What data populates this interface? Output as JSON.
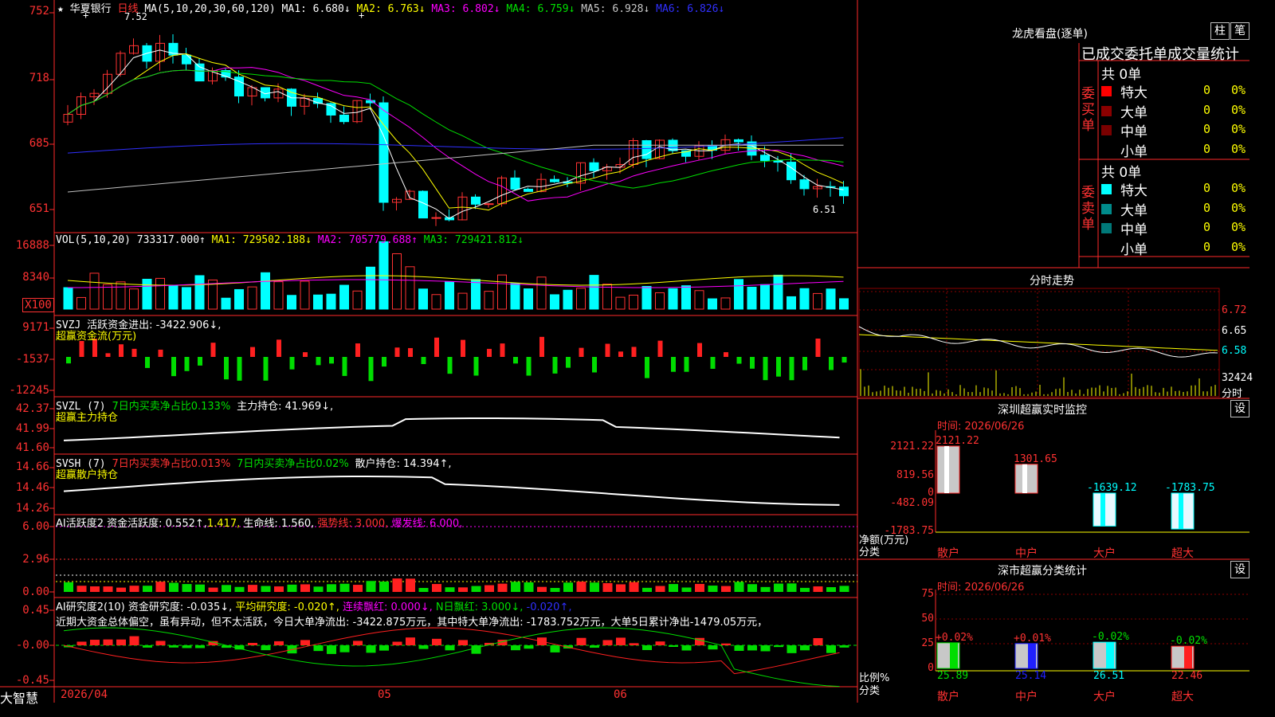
{
  "stock": {
    "star": "★",
    "name": "华夏银行",
    "period": "日线",
    "ma_prefix": "MA(5,10,20,30,60,120)",
    "ma1": "MA1: 6.680↓",
    "ma2": "MA2: 6.763↓",
    "ma3": "MA3: 6.802↓",
    "ma4": "MA4: 6.759↓",
    "ma5": "MA5: 6.928↓",
    "ma6": "MA6: 6.826↓",
    "high_mark": "7.52",
    "low_mark": "6.51"
  },
  "price_axis": [
    "752",
    "718",
    "685",
    "651"
  ],
  "vol_panel": {
    "title": "VOL(5,10,20)",
    "value": "733317.000↑",
    "ma1": "MA1: 729502.188↓",
    "ma2": "MA2: 705779.688↑",
    "ma3": "MA3: 729421.812↓",
    "axis": [
      "16888",
      "8340",
      "X100"
    ]
  },
  "svzj_panel": {
    "title": "SVZJ",
    "text": "活跃资金进出: -3422.906↓,",
    "subtitle": "超赢资金流(万元)",
    "axis": [
      "9171",
      "-1537",
      "-12245"
    ]
  },
  "svzl_panel": {
    "title": "SVZL (7)",
    "t1": "7日内买卖净占比0.133%",
    "t2": "主力持仓: 41.969↓,",
    "subtitle": "超赢主力持仓",
    "axis": [
      "42.37",
      "41.99",
      "41.60"
    ]
  },
  "svsh_panel": {
    "title": "SVSH (7)",
    "t1": "7日内买卖净占比0.013%",
    "t2": "7日内买卖净占比0.02%",
    "t3": "散户持仓: 14.394↑,",
    "subtitle": "超赢散户持仓",
    "axis": [
      "14.66",
      "14.46",
      "14.26"
    ]
  },
  "ai_active": {
    "title": "AI活跃度2",
    "t1": "资金活跃度: 0.552↑,",
    "t2": "1.417,",
    "t3": "生命线: 1.560,",
    "t4": "强势线: 3.000,",
    "t5": "爆发线: 6.000,",
    "axis": [
      "6.00",
      "2.96",
      "0.00"
    ]
  },
  "ai_research": {
    "title": "AI研究度2(10)",
    "t1": "资金研究度: -0.035↓,",
    "t2": "平均研究度: -0.020↑,",
    "t3": "连续飘红: 0.000↓,",
    "t4": "N日飘红: 3.000↓,",
    "t5": "-0.020↑,",
    "desc": "近期大资金总体偏空，虽有异动，但不太活跃，今日大单净流出: -3422.875万元，其中特大单净流出: -1783.752万元，大单5日累计净出-1479.05万元，",
    "axis": [
      "0.45",
      "-0.00",
      "-0.45"
    ]
  },
  "x_dates": [
    "2026/04",
    "05",
    "06"
  ],
  "brand": "大智慧",
  "dragon": {
    "title": "龙虎看盘(逐单)",
    "btn1": "柱",
    "btn2": "笔",
    "header": "已成交委托单成交量统计",
    "buy": {
      "label": "委买单",
      "total": "共 0单",
      "rows": [
        {
          "name": "特大",
          "v": "0",
          "p": "0%",
          "color": "#ff0000"
        },
        {
          "name": "大单",
          "v": "0",
          "p": "0%",
          "color": "#8b0000"
        },
        {
          "name": "中单",
          "v": "0",
          "p": "0%",
          "color": "#7a0000"
        },
        {
          "name": "小单",
          "v": "0",
          "p": "0%",
          "color": "#000000"
        }
      ]
    },
    "sell": {
      "label": "委卖单",
      "total": "共 0单",
      "rows": [
        {
          "name": "特大",
          "v": "0",
          "p": "0%",
          "color": "#00ffff"
        },
        {
          "name": "大单",
          "v": "0",
          "p": "0%",
          "color": "#008b8b"
        },
        {
          "name": "中单",
          "v": "0",
          "p": "0%",
          "color": "#007878"
        },
        {
          "name": "小单",
          "v": "0",
          "p": "0%",
          "color": "#000000"
        }
      ]
    }
  },
  "intraday": {
    "title": "分时走势",
    "axis": [
      "6.72",
      "6.65",
      "6.58"
    ],
    "vol": "32424",
    "unit": "分时"
  },
  "sz_monitor": {
    "title": "深圳超赢实时监控",
    "btn": "设",
    "time": "时间: 2026/06/26",
    "axis": [
      "2121.22",
      "819.56",
      "0",
      "-482.09",
      "-1783.75"
    ],
    "yl1": "净额(万元)",
    "yl2": "分类",
    "bars": [
      {
        "label": "散户",
        "value": 2121.22,
        "text": "2121.22"
      },
      {
        "label": "中户",
        "value": 1301.65,
        "text": "1301.65"
      },
      {
        "label": "大户",
        "value": -1639.12,
        "text": "-1639.12"
      },
      {
        "label": "超大",
        "value": -1783.75,
        "text": "-1783.75"
      }
    ]
  },
  "sz_class": {
    "title": "深市超赢分类统计",
    "btn": "设",
    "time": "时间: 2026/06/26",
    "axis": [
      "75",
      "50",
      "25",
      "0"
    ],
    "yl1": "比例%",
    "yl2": "分类",
    "bars": [
      {
        "label": "散户",
        "value": 25.89,
        "text": "25.89",
        "change": "+0.02%",
        "color": "#00dd00"
      },
      {
        "label": "中户",
        "value": 25.14,
        "text": "25.14",
        "change": "+0.01%",
        "color": "#2020ff"
      },
      {
        "label": "大户",
        "value": 26.51,
        "text": "26.51",
        "change": "-0.02%",
        "color": "#00ffff"
      },
      {
        "label": "超大",
        "value": 22.46,
        "text": "22.46",
        "change": "-0.02%",
        "color": "#ff2020"
      }
    ]
  }
}
